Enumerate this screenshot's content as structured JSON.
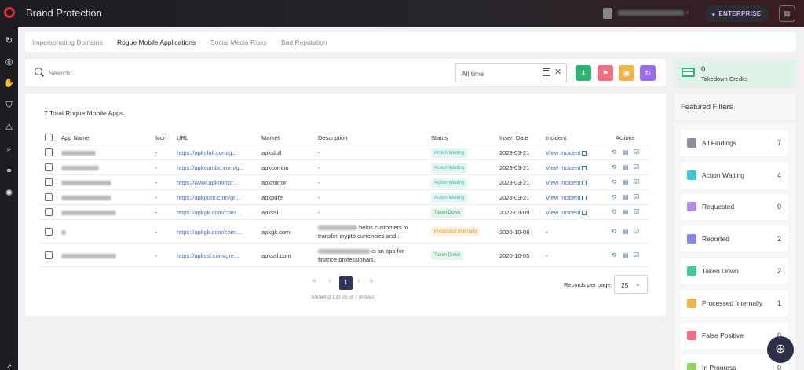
{
  "app": {
    "title": "Brand Protection"
  },
  "header": {
    "plan_label": "ENTERPRISE"
  },
  "tabs": [
    {
      "label": "Impersonating Domains",
      "active": false
    },
    {
      "label": "Rogue Mobile Applications",
      "active": true
    },
    {
      "label": "Social Media Risks",
      "active": false
    },
    {
      "label": "Bad Reputation",
      "active": false
    }
  ],
  "search": {
    "placeholder": "Search...",
    "value": ""
  },
  "date_filter": {
    "value": "All time"
  },
  "credits": {
    "count": "0",
    "label": "Takedown Credits"
  },
  "table": {
    "total_label": "7 Total Rogue Mobile Apps",
    "columns": [
      "App Name",
      "Icon",
      "URL",
      "Market",
      "Description",
      "Status",
      "Insert Date",
      "Incident",
      "Actions"
    ],
    "rows": [
      {
        "icon": "-",
        "url": "https://apksfull.com/g...",
        "market": "apksfull",
        "desc_pre": "",
        "desc_mid": "-",
        "desc_post": "",
        "status": "Action Waiting",
        "status_type": "waiting",
        "date": "2023-03-21",
        "incident": "View Incident"
      },
      {
        "icon": "-",
        "url": "https://apkcombo.com/g...",
        "market": "apkcombo",
        "desc_pre": "",
        "desc_mid": "-",
        "desc_post": "",
        "status": "Action Waiting",
        "status_type": "waiting",
        "date": "2023-03-21",
        "incident": "View Incident"
      },
      {
        "icon": "-",
        "url": "https://www.apkmirror....",
        "market": "apkmirror",
        "desc_pre": "",
        "desc_mid": "-",
        "desc_post": "",
        "status": "Action Waiting",
        "status_type": "waiting",
        "date": "2023-03-21",
        "incident": "View Incident"
      },
      {
        "icon": "-",
        "url": "https://apkpure.com/gr...",
        "market": "apkpure",
        "desc_pre": "",
        "desc_mid": "-",
        "desc_post": "",
        "status": "Action Waiting",
        "status_type": "waiting",
        "date": "2023-03-21",
        "incident": "View Incident"
      },
      {
        "icon": "-",
        "url": "https://apkgk.com/com....",
        "market": "apkssl",
        "desc_pre": "",
        "desc_mid": "-",
        "desc_post": "",
        "status": "Taken Down",
        "status_type": "down",
        "date": "2022-03-09",
        "incident": "View Incident"
      },
      {
        "icon": "-",
        "url": "https://apkgk.com/com....",
        "market": "apkgk.com",
        "desc_pre": "helps customers to",
        "desc_mid": "transfer crypto currencies and...",
        "desc_post": "",
        "status": "Processed Internally",
        "status_type": "processed",
        "date": "2020-10-08",
        "incident": "-"
      },
      {
        "icon": "-",
        "url": "https://apkssl.com/gre...",
        "market": "apkssl.com",
        "desc_pre": "is an app for",
        "desc_mid": "finance professionals.",
        "desc_post": "",
        "status": "Taken Down",
        "status_type": "down",
        "date": "2020-10-05",
        "incident": "-"
      }
    ]
  },
  "pagination": {
    "current_page": "1",
    "showing": "Showing 1 to 25 of 7 entries",
    "records_label": "Records per page:",
    "records_value": "25"
  },
  "filters": {
    "title": "Featured Filters",
    "items": [
      {
        "label": "All Findings",
        "count": "7",
        "color": "#8a8e96"
      },
      {
        "label": "Action Waiting",
        "count": "4",
        "color": "#3ec9d6"
      },
      {
        "label": "Requested",
        "count": "0",
        "color": "#b28cf0"
      },
      {
        "label": "Reported",
        "count": "2",
        "color": "#8b86e8"
      },
      {
        "label": "Taken Down",
        "count": "2",
        "color": "#3ec99a"
      },
      {
        "label": "Processed Internally",
        "count": "1",
        "color": "#f0b44c"
      },
      {
        "label": "False Positive",
        "count": "0",
        "color": "#ef6f86"
      },
      {
        "label": "In Progress",
        "count": "0",
        "color": "#8fd65a"
      }
    ]
  },
  "colors": {
    "accent": "#34355a",
    "link": "#3a6fc2",
    "brand_red": "#e0303a"
  }
}
